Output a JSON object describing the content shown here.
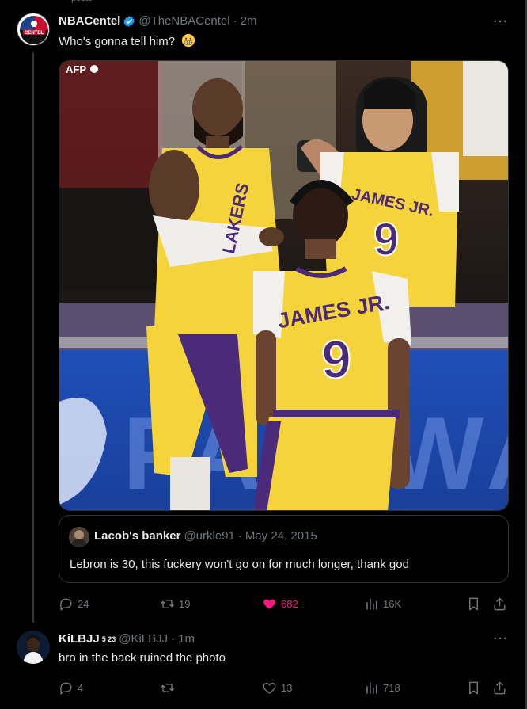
{
  "top_strip": {
    "text": "posts"
  },
  "tweet": {
    "author": {
      "name": "NBACentel",
      "handle": "@TheNBACentel",
      "time": "2m",
      "avatar_text": "CENTEL"
    },
    "text": "Who's gonna tell him?",
    "emoji": "grimacing-face",
    "image": {
      "watermark": "AFP",
      "jersey_name": "JAMES JR.",
      "jersey_number": "9",
      "shirt_text": "LAKERS",
      "fan_jersey_name": "JAMES JR.",
      "fan_jersey_number": "9",
      "court_sign": "FAIRWAY"
    },
    "quote": {
      "name": "Lacob's banker",
      "handle": "@urkle91",
      "date": "May 24, 2015",
      "text": "Lebron is 30, this fuckery won't go on for much longer, thank god"
    },
    "actions": {
      "replies": "24",
      "reposts": "19",
      "likes": "682",
      "views": "16K"
    }
  },
  "reply": {
    "author": {
      "name": "KiLBJJ",
      "badge": "5 23",
      "handle": "@KiLBJJ",
      "time": "1m"
    },
    "text": "bro in the back ruined the photo",
    "actions": {
      "replies": "4",
      "reposts": "",
      "likes": "13",
      "views": "718"
    }
  },
  "colors": {
    "background": "#000000",
    "text": "#e7e9ea",
    "muted": "#71767b",
    "like": "#f91880",
    "verified": "#1d9bf0",
    "lakers_gold": "#f5d33b",
    "lakers_purple": "#4b2a7a"
  }
}
